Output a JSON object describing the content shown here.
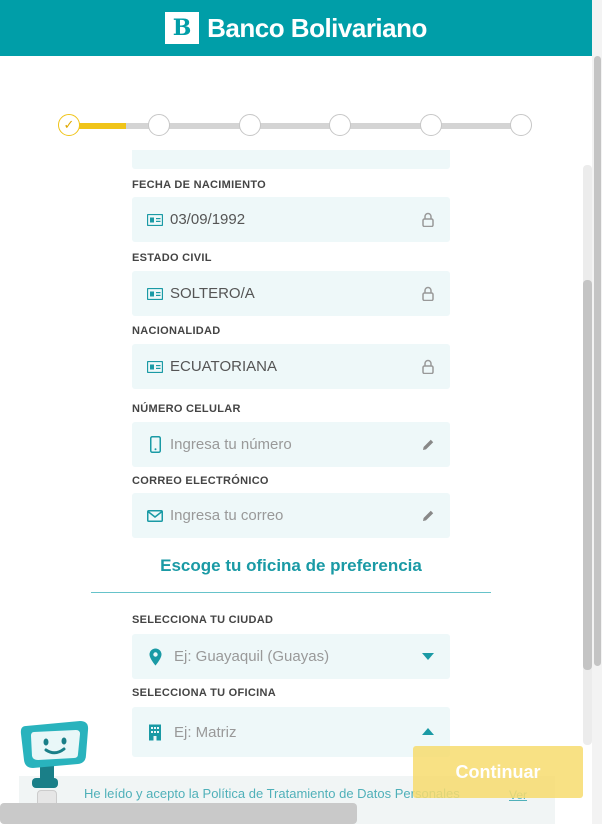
{
  "header": {
    "logo_mark": "B",
    "brand_name": "Banco Bolivariano"
  },
  "stepper": {
    "total_steps": 6,
    "current_step": 1,
    "completed_check": "✓"
  },
  "form": {
    "fecha_label": "FECHA DE NACIMIENTO",
    "fecha_value": "03/09/1992",
    "estado_label": "ESTADO CIVIL",
    "estado_value": "SOLTERO/A",
    "nacionalidad_label": "NACIONALIDAD",
    "nacionalidad_value": "ECUATORIANA",
    "celular_label": "NÚMERO CELULAR",
    "celular_placeholder": "Ingresa tu número",
    "correo_label": "CORREO ELECTRÓNICO",
    "correo_placeholder": "Ingresa tu correo"
  },
  "office": {
    "section_title": "Escoge tu oficina de preferencia",
    "ciudad_label": "SELECCIONA TU CIUDAD",
    "ciudad_placeholder": "Ej: Guayaquil (Guayas)",
    "oficina_label": "SELECCIONA TU OFICINA",
    "oficina_placeholder": "Ej: Matriz"
  },
  "footer": {
    "consent_text": "He leído y acepto la Política de Tratamiento de Datos Personales",
    "consent_link": "Ver",
    "continue_label": "Continuar"
  },
  "colors": {
    "brand_teal": "#009ea8",
    "accent_yellow": "#f0c419",
    "field_bg": "#eef8f9"
  }
}
